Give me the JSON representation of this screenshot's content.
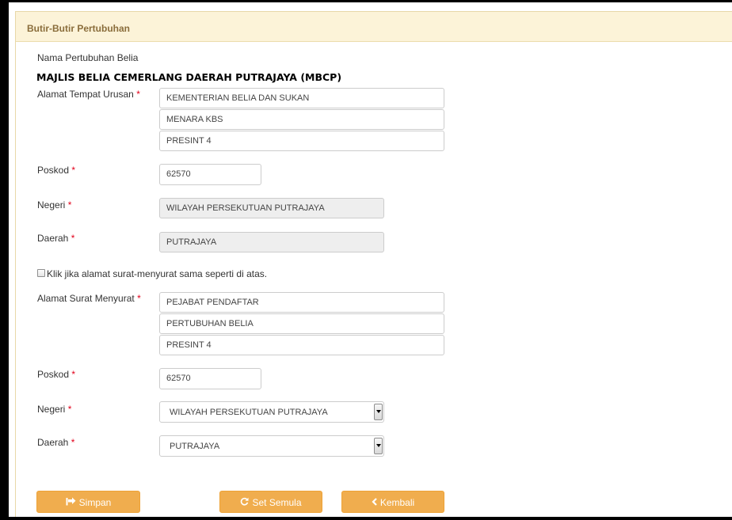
{
  "panel": {
    "title": "Butir-Butir Pertubuhan"
  },
  "organization": {
    "label": "Nama Pertubuhan Belia",
    "name": "MAJLIS BELIA CEMERLANG DAERAH PUTRAJAYA (MBCP)"
  },
  "business_address": {
    "label": "Alamat Tempat Urusan",
    "required_mark": "*",
    "line1": "KEMENTERIAN BELIA DAN SUKAN",
    "line2": "MENARA KBS",
    "line3": "PRESINT 4",
    "postcode_label": "Poskod",
    "postcode": "62570",
    "state_label": "Negeri",
    "state": "WILAYAH PERSEKUTUAN PUTRAJAYA",
    "district_label": "Daerah",
    "district": "PUTRAJAYA"
  },
  "same_address_checkbox": {
    "label": "Klik jika alamat surat-menyurat sama seperti di atas.",
    "checked": false
  },
  "mailing_address": {
    "label": "Alamat Surat Menyurat",
    "required_mark": "*",
    "line1": "PEJABAT PENDAFTAR",
    "line2": "PERTUBUHAN BELIA",
    "line3": "PRESINT 4",
    "postcode_label": "Poskod",
    "postcode": "62570",
    "state_label": "Negeri",
    "state": "WILAYAH PERSEKUTUAN PUTRAJAYA",
    "district_label": "Daerah",
    "district": "PUTRAJAYA"
  },
  "buttons": {
    "save": "Simpan",
    "reset": "Set Semula",
    "back": "Kembali"
  },
  "colors": {
    "button": "#f0ad4e",
    "header_bg": "#fcf3d8",
    "header_text": "#8a6d3b",
    "required": "#e2001a"
  },
  "icons": {
    "save": "share-square-icon",
    "reset": "refresh-icon",
    "back": "chevron-left-icon"
  }
}
